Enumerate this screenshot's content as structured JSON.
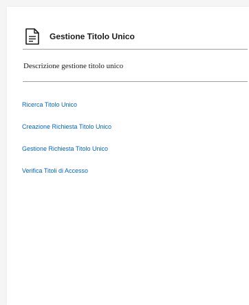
{
  "card": {
    "icon": "document-icon",
    "title": "Gestione Titolo Unico",
    "description": "Descrizione gestione titolo unico",
    "links": [
      {
        "label": "Ricerca Titolo Unico"
      },
      {
        "label": "Creazione Richiesta Titolo Unico"
      },
      {
        "label": "Gestione Richiesta Titolo Unico"
      },
      {
        "label": "Verifica Titoli di Accesso"
      }
    ]
  },
  "colors": {
    "link": "#0066cc",
    "text": "#1a1a1a",
    "divider": "#9aa0a6",
    "background": "#ffffff"
  }
}
